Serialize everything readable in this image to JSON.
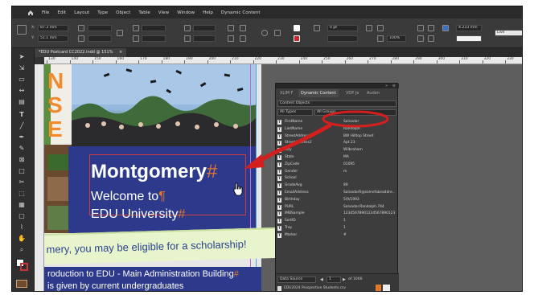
{
  "menu": {
    "items": [
      "File",
      "Edit",
      "Layout",
      "Type",
      "Object",
      "Table",
      "View",
      "Window",
      "Help",
      "Dynamic Content"
    ]
  },
  "control_bar": {
    "x_label": "X:",
    "y_label": "Y:",
    "x_value": "87.3 mm",
    "y_value": "51.1 mm",
    "stroke_weight": "0 pt",
    "zoom": "100%",
    "dimension": "4.233 mm",
    "style_name": "Live"
  },
  "document_tab": {
    "label": "*EDU Postcard CC2022.indd @ 151%",
    "close": "×"
  },
  "ruler": {
    "ticks": [
      "130",
      "140",
      "150",
      "160",
      "170",
      "180",
      "190",
      "200",
      "210",
      "220",
      "230",
      "240",
      "250",
      "260",
      "270",
      "280",
      "290",
      "300",
      "310",
      "320",
      "330"
    ]
  },
  "postcard": {
    "title": "Montgomery",
    "title_marker": "#",
    "line1": "Welcome to",
    "line1_marker": "¶",
    "line2": "EDU University",
    "line2_marker": "#",
    "banner": "mery, you may be eligible for a scholarship!",
    "bottom1": "roduction to EDU - Main Administration Building",
    "bottom1_marker": "#",
    "bottom2": "is given by current undergraduates",
    "strip_letters": "NSE"
  },
  "panel": {
    "tabs": [
      "XLIM F",
      "Dynamic Content",
      "VDP Je",
      "Auden"
    ],
    "source_select": "Content Objects",
    "type_select": "All Types",
    "group_select": "All Groups",
    "fields": [
      {
        "name": "FirstName",
        "value": "Salvador"
      },
      {
        "name": "LastName",
        "value": "Randolph"
      },
      {
        "name": "StreetAddress",
        "value": "BW Hilltop Street"
      },
      {
        "name": "StreetAddress2",
        "value": "Apt 23"
      },
      {
        "name": "City",
        "value": "Wilbraham"
      },
      {
        "name": "State",
        "value": "MA"
      },
      {
        "name": "ZipCode",
        "value": "01095"
      },
      {
        "name": "Gender",
        "value": "m"
      },
      {
        "name": "School",
        "value": ""
      },
      {
        "name": "GradeAvg",
        "value": "89"
      },
      {
        "name": "EmailAddress",
        "value": "SalvadorR@somefakeaddre..."
      },
      {
        "name": "Birthday",
        "value": "5/9/1993"
      },
      {
        "name": "PURL",
        "value": "Salvador.Randolph.744"
      },
      {
        "name": "IMBSample",
        "value": "1234567890123456789012345..."
      },
      {
        "name": "SortID",
        "value": "1"
      },
      {
        "name": "Tray",
        "value": "1"
      },
      {
        "name": "Marker",
        "value": "#"
      }
    ],
    "footer": {
      "data_source_label": "Data Source",
      "record": "1",
      "record_total": "of 1000",
      "file_name": "EDU2024 Prospective Students.csv"
    }
  },
  "colors": {
    "annotation_red": "#d41f1f",
    "postcard_blue": "#2d3a8b",
    "marker_orange": "#e2762f"
  }
}
